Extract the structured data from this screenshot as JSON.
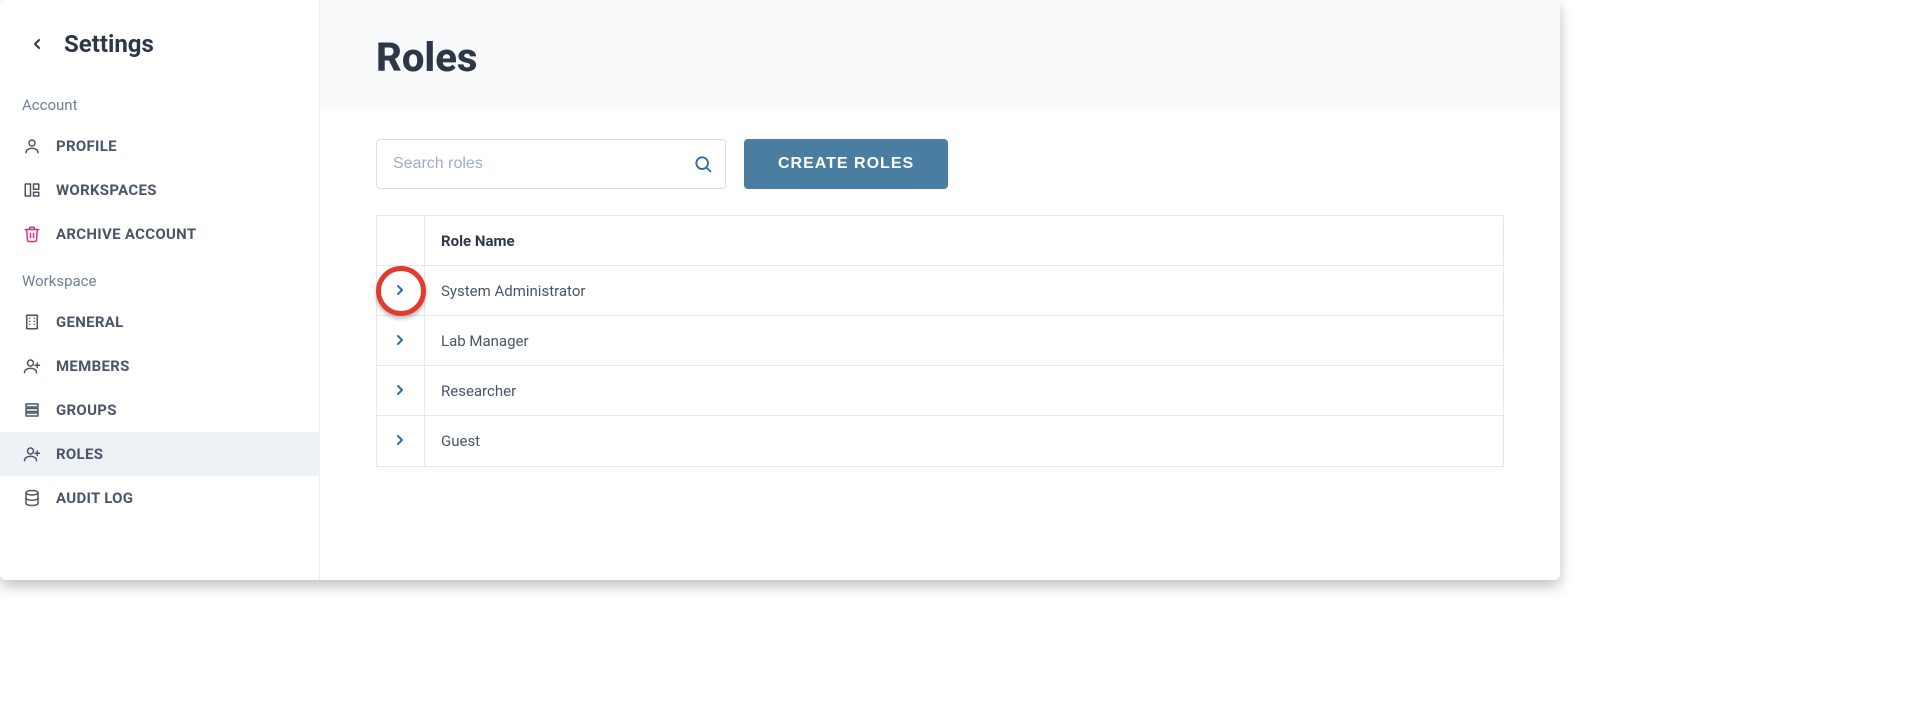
{
  "sidebar": {
    "title": "Settings",
    "sections": [
      {
        "label": "Account",
        "items": [
          {
            "id": "profile",
            "label": "PROFILE",
            "icon": "person"
          },
          {
            "id": "workspaces",
            "label": "WORKSPACES",
            "icon": "workspaces"
          },
          {
            "id": "archive-account",
            "label": "ARCHIVE ACCOUNT",
            "icon": "trash",
            "iconColor": "pink"
          }
        ]
      },
      {
        "label": "Workspace",
        "items": [
          {
            "id": "general",
            "label": "GENERAL",
            "icon": "building"
          },
          {
            "id": "members",
            "label": "MEMBERS",
            "icon": "person-plus"
          },
          {
            "id": "groups",
            "label": "GROUPS",
            "icon": "stack"
          },
          {
            "id": "roles",
            "label": "ROLES",
            "icon": "person-plus",
            "active": true
          },
          {
            "id": "audit-log",
            "label": "AUDIT LOG",
            "icon": "database"
          }
        ]
      }
    ]
  },
  "page": {
    "title": "Roles",
    "search_placeholder": "Search roles",
    "create_button": "CREATE ROLES"
  },
  "table": {
    "header": {
      "role_name": "Role Name"
    },
    "rows": [
      {
        "name": "System Administrator",
        "highlighted": true
      },
      {
        "name": "Lab Manager"
      },
      {
        "name": "Researcher"
      },
      {
        "name": "Guest"
      }
    ]
  },
  "colors": {
    "accent": "#4a7ea1",
    "highlight_ring": "#e23b2e",
    "archive_icon": "#d63384"
  }
}
